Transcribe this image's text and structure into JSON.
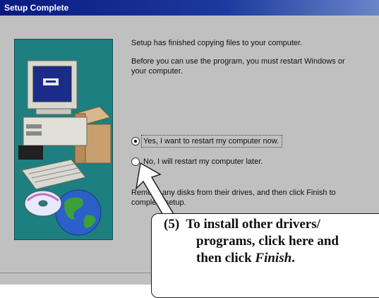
{
  "window": {
    "title": "Setup Complete"
  },
  "dialog": {
    "line1": "Setup has finished copying files to your computer.",
    "line2a": "Before you can use the program, you must restart Windows or",
    "line2b": "your computer.",
    "option_yes": "Yes, I want to restart my computer now.",
    "option_no": "No, I will restart my computer later.",
    "remove_a": "Remove any disks from their drives, and then click Finish to",
    "remove_b": "complete setup."
  },
  "callout": {
    "number": "(5)",
    "line1": "To install other drivers/",
    "line2": "programs, click here and",
    "line3_prefix": "then click ",
    "line3_italic": "Finish",
    "line3_suffix": "."
  },
  "colors": {
    "panel": "#1e7f80",
    "titlebar": "#0a1a80",
    "window": "#c0c0c0"
  }
}
